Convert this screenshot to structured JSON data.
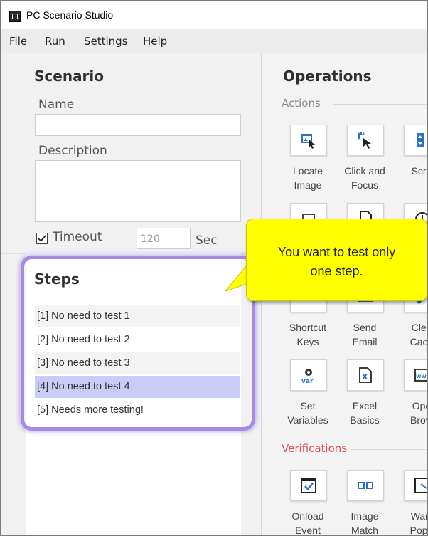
{
  "window": {
    "title": "PC Scenario Studio"
  },
  "menu": [
    "File",
    "Run",
    "Settings",
    "Help"
  ],
  "scenario": {
    "heading": "Scenario",
    "name_label": "Name",
    "name_value": "",
    "description_label": "Description",
    "description_value": "",
    "timeout_label": "Timeout",
    "timeout_checked": true,
    "timeout_value": "120",
    "timeout_unit": "Sec"
  },
  "steps": {
    "heading": "Steps",
    "items": [
      "[1] No need to test 1",
      "[2] No need to test 2",
      "[3] No need to test 3",
      "[4] No need to test 4",
      "[5] Needs more testing!"
    ],
    "selected_index": 3
  },
  "operations": {
    "heading": "Operations",
    "actions_label": "Actions",
    "verifications_label": "Verifications",
    "actions": [
      {
        "label1": "Locate",
        "label2": "Image",
        "icon": "locate-image-icon"
      },
      {
        "label1": "Click and",
        "label2": "Focus",
        "icon": "click-focus-icon"
      },
      {
        "label1": "Scro",
        "label2": "",
        "icon": "scroll-icon"
      },
      {
        "label1": "",
        "label2": "",
        "icon": "operation-icon"
      },
      {
        "label1": "",
        "label2": "",
        "icon": "document-icon"
      },
      {
        "label1": "",
        "label2": "",
        "icon": "timer-icon"
      },
      {
        "label1": "Shortcut",
        "label2": "Keys",
        "icon": "keyboard-icon"
      },
      {
        "label1": "Send",
        "label2": "Email",
        "icon": "email-icon"
      },
      {
        "label1": "Clea",
        "label2": "Cach",
        "icon": "clear-cache-icon"
      },
      {
        "label1": "Set",
        "label2": "Variables",
        "icon": "set-variables-icon"
      },
      {
        "label1": "Excel",
        "label2": "Basics",
        "icon": "excel-icon"
      },
      {
        "label1": "Ope",
        "label2": "Brow",
        "icon": "open-browser-icon"
      }
    ],
    "verifications": [
      {
        "label1": "Onload",
        "label2": "Event",
        "icon": "onload-event-icon"
      },
      {
        "label1": "Image",
        "label2": "Match",
        "icon": "image-match-icon"
      },
      {
        "label1": "Waiti",
        "label2": "Popu",
        "icon": "wait-popup-icon"
      }
    ]
  },
  "callout": {
    "line1": "You want to test only",
    "line2": "one step."
  },
  "colors": {
    "selection": "#c9ccf5",
    "highlight": "#a58be6",
    "callout": "#ffff00",
    "verifications": "#e05050",
    "icon_blue": "#2a70c8"
  }
}
